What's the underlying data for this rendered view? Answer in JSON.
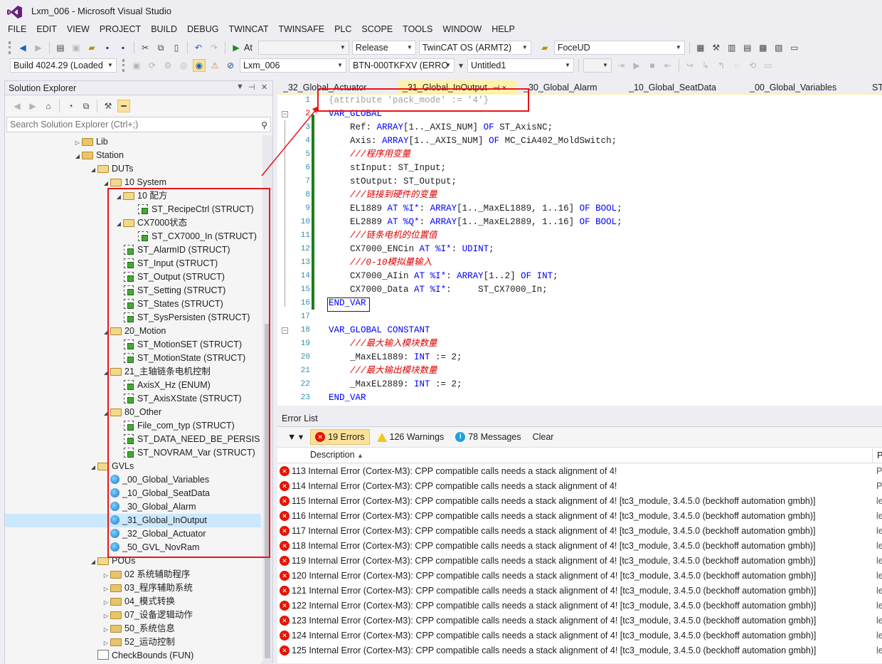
{
  "window": {
    "title": "Lxm_006 - Microsoft Visual Studio"
  },
  "menu": [
    "FILE",
    "EDIT",
    "VIEW",
    "PROJECT",
    "BUILD",
    "DEBUG",
    "TWINCAT",
    "TWINSAFE",
    "PLC",
    "SCOPE",
    "TOOLS",
    "WINDOW",
    "HELP"
  ],
  "toolbar1": {
    "attach_label": "At",
    "config": "Release",
    "platform": "TwinCAT OS (ARMT2)",
    "find": "FoceUD"
  },
  "toolbar2": {
    "build": "Build 4024.29 (Loaded",
    "project": "Lxm_006",
    "target": "BTN-000TKFXV (ERRO",
    "untitled": "Untitled1"
  },
  "solution_explorer": {
    "title": "Solution Explorer",
    "search_placeholder": "Search Solution Explorer (Ctrl+;)",
    "items": [
      {
        "label": "Lib",
        "indent": 0,
        "icon": "folder",
        "exp": "closed"
      },
      {
        "label": "Station",
        "indent": 0,
        "icon": "folder",
        "exp": "open"
      },
      {
        "label": "DUTs",
        "indent": 1,
        "icon": "folder-open",
        "exp": "open"
      },
      {
        "label": "10 System",
        "indent": 2,
        "icon": "folder-open",
        "exp": "open"
      },
      {
        "label": "10 配方",
        "indent": 3,
        "icon": "folder-open",
        "exp": "open"
      },
      {
        "label": "ST_RecipeCtrl (STRUCT)",
        "indent": 4,
        "icon": "struct",
        "exp": ""
      },
      {
        "label": "CX7000状态",
        "indent": 3,
        "icon": "folder-open",
        "exp": "open"
      },
      {
        "label": "ST_CX7000_In (STRUCT)",
        "indent": 4,
        "icon": "struct",
        "exp": ""
      },
      {
        "label": "ST_AlarmID (STRUCT)",
        "indent": 3,
        "icon": "struct",
        "exp": ""
      },
      {
        "label": "ST_Input (STRUCT)",
        "indent": 3,
        "icon": "struct",
        "exp": ""
      },
      {
        "label": "ST_Output (STRUCT)",
        "indent": 3,
        "icon": "struct",
        "exp": ""
      },
      {
        "label": "ST_Setting (STRUCT)",
        "indent": 3,
        "icon": "struct",
        "exp": ""
      },
      {
        "label": "ST_States (STRUCT)",
        "indent": 3,
        "icon": "struct",
        "exp": ""
      },
      {
        "label": "ST_SysPersisten (STRUCT)",
        "indent": 3,
        "icon": "struct",
        "exp": ""
      },
      {
        "label": "20_Motion",
        "indent": 2,
        "icon": "folder-open",
        "exp": "open"
      },
      {
        "label": "ST_MotionSET (STRUCT)",
        "indent": 3,
        "icon": "struct",
        "exp": ""
      },
      {
        "label": "ST_MotionState (STRUCT)",
        "indent": 3,
        "icon": "struct",
        "exp": ""
      },
      {
        "label": "21_主轴链条电机控制",
        "indent": 2,
        "icon": "folder-open",
        "exp": "open"
      },
      {
        "label": "AxisX_Hz (ENUM)",
        "indent": 3,
        "icon": "struct",
        "exp": ""
      },
      {
        "label": "ST_AxisXState (STRUCT)",
        "indent": 3,
        "icon": "struct",
        "exp": ""
      },
      {
        "label": "80_Other",
        "indent": 2,
        "icon": "folder-open",
        "exp": "open"
      },
      {
        "label": "File_com_typ (STRUCT)",
        "indent": 3,
        "icon": "struct",
        "exp": ""
      },
      {
        "label": "ST_DATA_NEED_BE_PERSIS (S",
        "indent": 3,
        "icon": "struct",
        "exp": ""
      },
      {
        "label": "ST_NOVRAM_Var (STRUCT)",
        "indent": 3,
        "icon": "struct",
        "exp": ""
      },
      {
        "label": "GVLs",
        "indent": 1,
        "icon": "folder-open",
        "exp": "open"
      },
      {
        "label": "_00_Global_Variables",
        "indent": 2,
        "icon": "gvl",
        "exp": ""
      },
      {
        "label": "_10_Global_SeatData",
        "indent": 2,
        "icon": "gvl",
        "exp": ""
      },
      {
        "label": "_30_Global_Alarm",
        "indent": 2,
        "icon": "gvl",
        "exp": ""
      },
      {
        "label": "_31_Global_InOutput",
        "indent": 2,
        "icon": "gvl",
        "exp": "",
        "selected": true
      },
      {
        "label": "_32_Global_Actuator",
        "indent": 2,
        "icon": "gvl",
        "exp": ""
      },
      {
        "label": "_50_GVL_NovRam",
        "indent": 2,
        "icon": "gvl",
        "exp": ""
      },
      {
        "label": "POUs",
        "indent": 1,
        "icon": "folder-open",
        "exp": "open"
      },
      {
        "label": "02 系统辅助程序",
        "indent": 2,
        "icon": "folder",
        "exp": "closed"
      },
      {
        "label": "03_程序辅助系统",
        "indent": 2,
        "icon": "folder",
        "exp": "closed"
      },
      {
        "label": "04_模式转换",
        "indent": 2,
        "icon": "folder",
        "exp": "closed"
      },
      {
        "label": "07_设备逻辑动作",
        "indent": 2,
        "icon": "folder",
        "exp": "closed"
      },
      {
        "label": "50_系统信息",
        "indent": 2,
        "icon": "folder",
        "exp": "closed"
      },
      {
        "label": "52_运动控制",
        "indent": 2,
        "icon": "folder",
        "exp": "closed"
      },
      {
        "label": "CheckBounds (FUN)",
        "indent": 1,
        "icon": "pou",
        "exp": ""
      }
    ]
  },
  "tabs": [
    "_32_Global_Actuator",
    "_31_Global_InOutput",
    "_30_Global_Alarm",
    "_10_Global_SeatData",
    "_00_Global_Variables",
    "ST"
  ],
  "tab_pin": "⊣ ×",
  "code": {
    "lines": [
      {
        "n": "1",
        "html": "<span class='attr'>{attribute 'pack_mode' := '4'}</span>"
      },
      {
        "n": "2",
        "html": "<span class='kw'>VAR_GLOBAL</span>"
      },
      {
        "n": "3",
        "html": "    Ref: <span class='kw'>ARRAY</span>[1.._AXIS_NUM] <span class='kw'>OF</span> ST_AxisNC;"
      },
      {
        "n": "4",
        "html": "    Axis: <span class='kw'>ARRAY</span>[1.._AXIS_NUM] <span class='kw'>OF</span> MC_CiA402_MoldSwitch;"
      },
      {
        "n": "5",
        "html": "    <span class='cmr'>///程序用变量</span>"
      },
      {
        "n": "6",
        "html": "    stInput: ST_Input;"
      },
      {
        "n": "7",
        "html": "    stOutput: ST_Output;"
      },
      {
        "n": "8",
        "html": "    <span class='cmr'>///链接到硬件的变量</span>"
      },
      {
        "n": "9",
        "html": "    EL1889 <span class='kw'>AT</span> <span class='kw'>%I*</span>: <span class='kw'>ARRAY</span>[1.._MaxEL1889, 1..16] <span class='kw'>OF</span> <span class='kw'>BOOL</span>;"
      },
      {
        "n": "10",
        "html": "    EL2889 <span class='kw'>AT</span> <span class='kw'>%Q*</span>: <span class='kw'>ARRAY</span>[1.._MaxEL2889, 1..16] <span class='kw'>OF</span> <span class='kw'>BOOL</span>;"
      },
      {
        "n": "11",
        "html": "    <span class='cmr'>///链条电机的位置值</span>"
      },
      {
        "n": "12",
        "html": "    CX7000_ENCin <span class='kw'>AT</span> <span class='kw'>%I*</span>: <span class='kw'>UDINT</span>;"
      },
      {
        "n": "13",
        "html": "    <span class='cmr'>///0-10模拟量输入</span>"
      },
      {
        "n": "14",
        "html": "    CX7000_AIin <span class='kw'>AT</span> <span class='kw'>%I*</span>: <span class='kw'>ARRAY</span>[1..2] <span class='kw'>OF</span> <span class='kw'>INT</span>;"
      },
      {
        "n": "15",
        "html": "    CX7000_Data <span class='kw'>AT</span> <span class='kw'>%I*</span>:     ST_CX7000_In;"
      },
      {
        "n": "16",
        "html": "<span class='kw'>END_VAR</span>"
      },
      {
        "n": "17",
        "html": ""
      },
      {
        "n": "18",
        "html": "<span class='kw'>VAR_GLOBAL</span> <span class='kw'>CONSTANT</span>"
      },
      {
        "n": "19",
        "html": "    <span class='cmr'>///最大输入模块数量</span>"
      },
      {
        "n": "20",
        "html": "    _MaxEL1889: <span class='kw'>INT</span> := 2;"
      },
      {
        "n": "21",
        "html": "    <span class='cmr'>///最大输出模块数量</span>"
      },
      {
        "n": "22",
        "html": "    _MaxEL2889: <span class='kw'>INT</span> := 2;"
      },
      {
        "n": "23",
        "html": "<span class='kw'>END_VAR</span>"
      }
    ]
  },
  "error_list": {
    "title": "Error List",
    "errors_label": "19 Errors",
    "warnings_label": "126 Warnings",
    "messages_label": "78 Messages",
    "clear_label": "Clear",
    "col_description": "Description",
    "col_project": "P",
    "rows": [
      {
        "text": "113 Internal Error (Cortex-M3): CPP compatible calls needs a stack alignment of 4!",
        "p": "P"
      },
      {
        "text": "114 Internal Error (Cortex-M3): CPP compatible calls needs a stack alignment of 4!",
        "p": "P"
      },
      {
        "text": "115 Internal Error (Cortex-M3): CPP compatible calls needs a stack alignment of 4! [tc3_module, 3.4.5.0 (beckhoff automation gmbh)]",
        "p": "le"
      },
      {
        "text": "116 Internal Error (Cortex-M3): CPP compatible calls needs a stack alignment of 4! [tc3_module, 3.4.5.0 (beckhoff automation gmbh)]",
        "p": "le"
      },
      {
        "text": "117 Internal Error (Cortex-M3): CPP compatible calls needs a stack alignment of 4! [tc3_module, 3.4.5.0 (beckhoff automation gmbh)]",
        "p": "le"
      },
      {
        "text": "118 Internal Error (Cortex-M3): CPP compatible calls needs a stack alignment of 4! [tc3_module, 3.4.5.0 (beckhoff automation gmbh)]",
        "p": "le"
      },
      {
        "text": "119 Internal Error (Cortex-M3): CPP compatible calls needs a stack alignment of 4! [tc3_module, 3.4.5.0 (beckhoff automation gmbh)]",
        "p": "le"
      },
      {
        "text": "120 Internal Error (Cortex-M3): CPP compatible calls needs a stack alignment of 4! [tc3_module, 3.4.5.0 (beckhoff automation gmbh)]",
        "p": "le"
      },
      {
        "text": "121 Internal Error (Cortex-M3): CPP compatible calls needs a stack alignment of 4! [tc3_module, 3.4.5.0 (beckhoff automation gmbh)]",
        "p": "le"
      },
      {
        "text": "122 Internal Error (Cortex-M3): CPP compatible calls needs a stack alignment of 4! [tc3_module, 3.4.5.0 (beckhoff automation gmbh)]",
        "p": "le"
      },
      {
        "text": "123 Internal Error (Cortex-M3): CPP compatible calls needs a stack alignment of 4! [tc3_module, 3.4.5.0 (beckhoff automation gmbh)]",
        "p": "le"
      },
      {
        "text": "124 Internal Error (Cortex-M3): CPP compatible calls needs a stack alignment of 4! [tc3_module, 3.4.5.0 (beckhoff automation gmbh)]",
        "p": "le"
      },
      {
        "text": "125 Internal Error (Cortex-M3): CPP compatible calls needs a stack alignment of 4! [tc3_module, 3.4.5.0 (beckhoff automation gmbh)]",
        "p": "le"
      }
    ]
  }
}
